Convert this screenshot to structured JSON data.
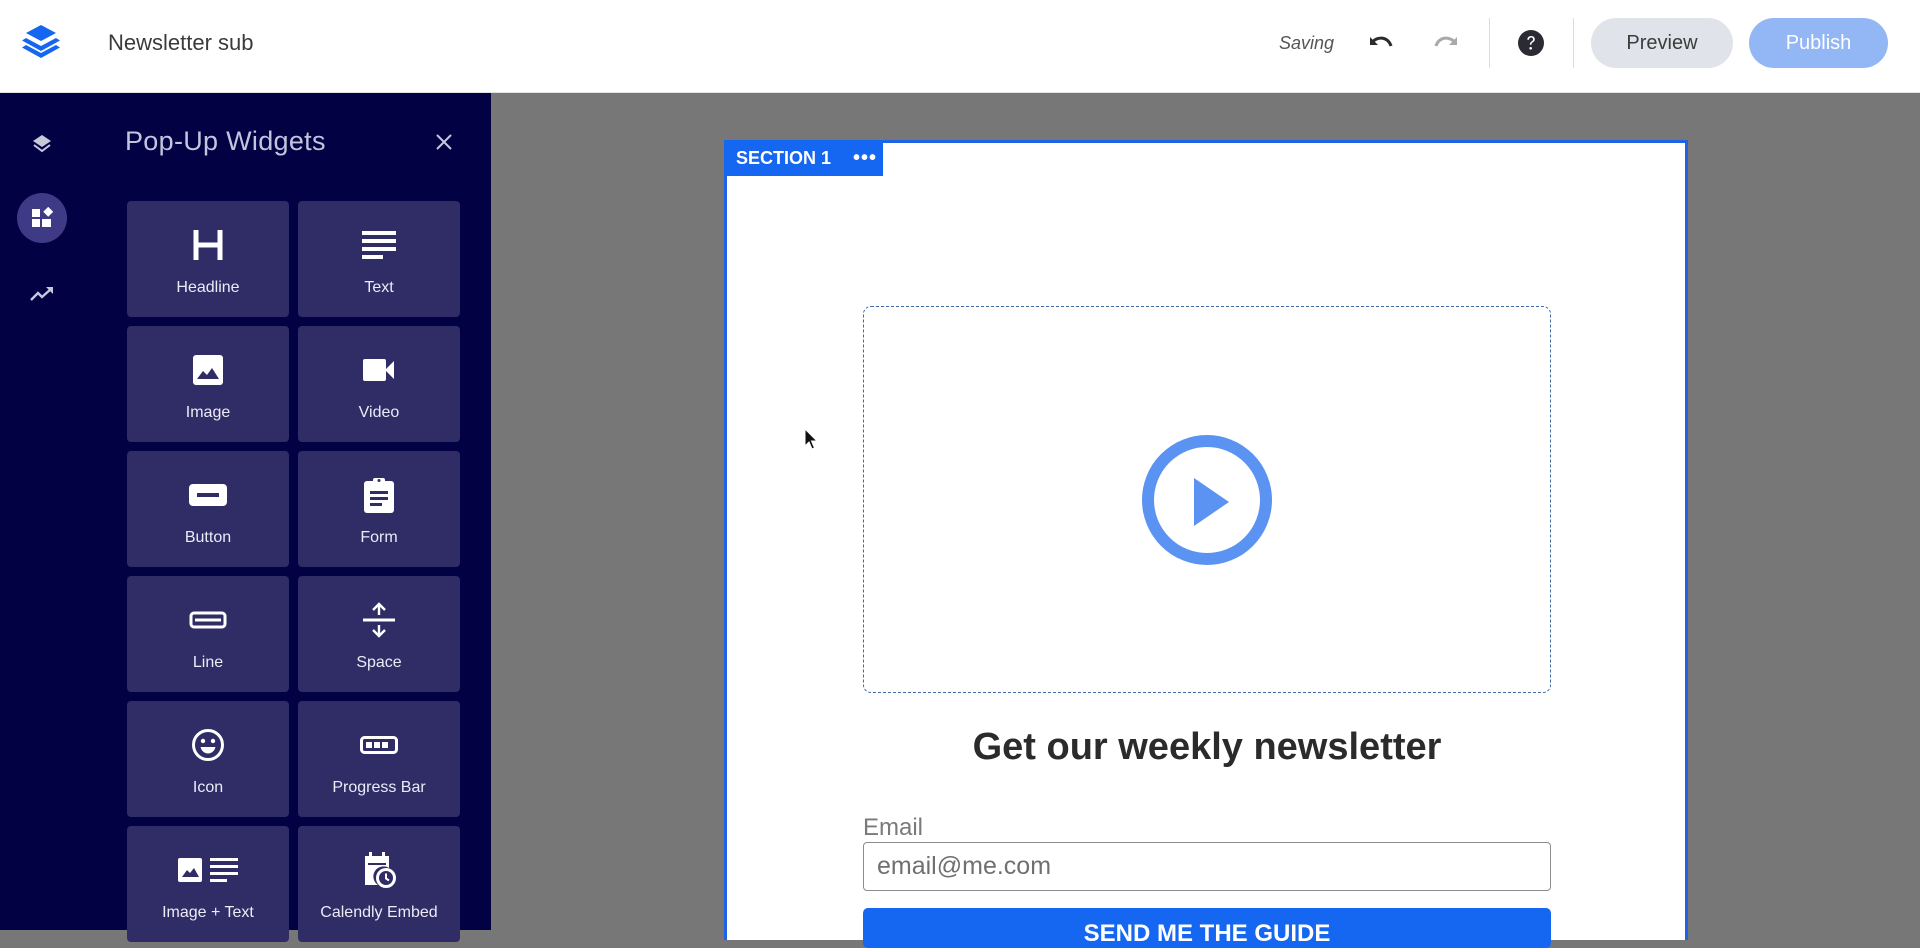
{
  "app": {
    "document_title": "Newsletter sub",
    "logo_icon": "stacked-layers-logo"
  },
  "toolbar": {
    "status": "Saving",
    "undo_icon": "undo-icon",
    "redo_icon": "redo-icon",
    "help_icon": "help-icon",
    "preview_label": "Preview",
    "publish_label": "Publish"
  },
  "rail": {
    "items": [
      {
        "name": "layers",
        "icon": "layers-icon",
        "active": false
      },
      {
        "name": "widgets",
        "icon": "widgets-icon",
        "active": true
      },
      {
        "name": "analytics",
        "icon": "trending-up-icon",
        "active": false
      }
    ]
  },
  "panel": {
    "title": "Pop-Up Widgets",
    "close_icon": "close-icon",
    "widgets": [
      {
        "label": "Headline",
        "icon": "headline-icon"
      },
      {
        "label": "Text",
        "icon": "text-icon"
      },
      {
        "label": "Image",
        "icon": "image-icon"
      },
      {
        "label": "Video",
        "icon": "video-icon"
      },
      {
        "label": "Button",
        "icon": "button-icon"
      },
      {
        "label": "Form",
        "icon": "form-icon"
      },
      {
        "label": "Line",
        "icon": "line-icon"
      },
      {
        "label": "Space",
        "icon": "space-icon"
      },
      {
        "label": "Icon",
        "icon": "smiley-icon"
      },
      {
        "label": "Progress Bar",
        "icon": "progress-bar-icon"
      },
      {
        "label": "Image + Text",
        "icon": "image-text-icon"
      },
      {
        "label": "Calendly Embed",
        "icon": "calendly-icon"
      }
    ]
  },
  "canvas": {
    "section_label": "SECTION 1",
    "section_menu": "•••",
    "video_placeholder_icon": "play-circle-icon",
    "headline": "Get our weekly newsletter",
    "email_label": "Email",
    "email_placeholder": "email@me.com",
    "email_value": "",
    "cta_label": "SEND ME THE GUIDE"
  },
  "colors": {
    "brand_blue": "#1566f0",
    "sidebar_bg": "#020144",
    "tile_bg": "#2f2c66",
    "publish_disabled": "#93b6f5",
    "play_icon": "#5b93f2"
  }
}
